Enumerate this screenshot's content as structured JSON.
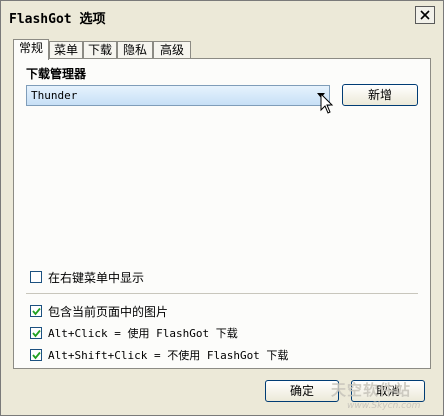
{
  "window": {
    "title": "FlashGot 选项"
  },
  "tabs": [
    "常规",
    "菜单",
    "下载",
    "隐私",
    "高级"
  ],
  "active_tab": "常规",
  "general": {
    "download_manager_label": "下载管理器",
    "download_manager_selected": "Thunder",
    "add_button": "新增",
    "checkboxes": [
      {
        "label": "在右键菜单中显示",
        "checked": false
      },
      {
        "label": "包含当前页面中的图片",
        "checked": true
      },
      {
        "label": "Alt+Click = 使用 FlashGot 下载",
        "checked": true
      },
      {
        "label": "Alt+Shift+Click = 不使用 FlashGot 下载",
        "checked": true
      }
    ]
  },
  "footer": {
    "ok_label": "确定",
    "cancel_label": "取消"
  },
  "watermark": {
    "text": "天空软件站",
    "url": "www.Skycn.com"
  }
}
